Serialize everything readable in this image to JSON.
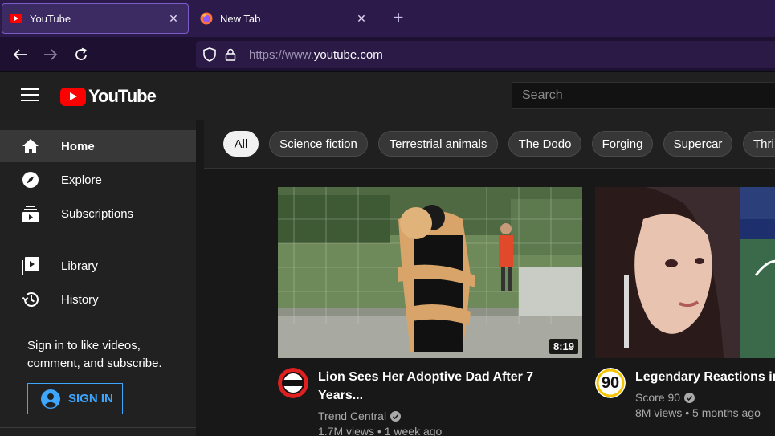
{
  "browser": {
    "tabs": [
      {
        "title": "YouTube",
        "close": "✕"
      },
      {
        "title": "New Tab",
        "close": "✕"
      }
    ],
    "new_tab_symbol": "+",
    "url_prefix": "https://www.",
    "url_domain": "youtube.com",
    "accent": "#7a5cc7"
  },
  "header": {
    "logo_text": "YouTube",
    "search_placeholder": "Search"
  },
  "sidebar": {
    "items": [
      {
        "label": "Home",
        "icon": "home-icon"
      },
      {
        "label": "Explore",
        "icon": "compass-icon"
      },
      {
        "label": "Subscriptions",
        "icon": "subscriptions-icon"
      },
      {
        "label": "Library",
        "icon": "library-icon"
      },
      {
        "label": "History",
        "icon": "history-icon"
      }
    ],
    "signin_prompt": "Sign in to like videos, comment, and subscribe.",
    "signin_button": "SIGN IN"
  },
  "chips": [
    "All",
    "Science fiction",
    "Terrestrial animals",
    "The Dodo",
    "Forging",
    "Supercar",
    "Thri"
  ],
  "videos": [
    {
      "title": "Lion Sees Her Adoptive Dad After 7 Years...",
      "channel": "Trend Central",
      "views": "1.7M views",
      "age": "1 week ago",
      "duration": "8:19"
    },
    {
      "title": "Legendary Reactions in",
      "channel": "Score 90",
      "views": "8M views",
      "age": "5 months ago",
      "avatar_text": "90"
    }
  ],
  "colors": {
    "youtube_red": "#ff0000",
    "link_blue": "#3ea6ff"
  }
}
